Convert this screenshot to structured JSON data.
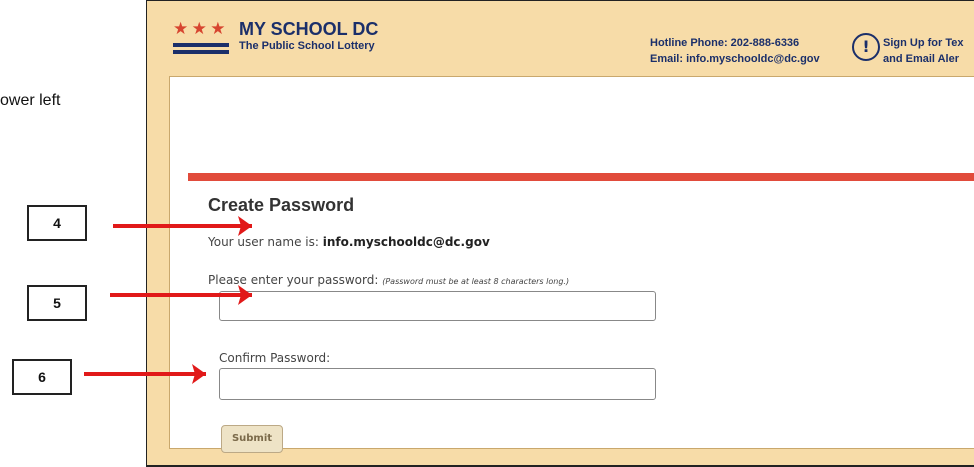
{
  "document": {
    "fragment": "ower left"
  },
  "header": {
    "brand": "MY SCHOOL DC",
    "tagline": "The Public School Lottery",
    "hotline": "Hotline Phone: 202-888-6336",
    "email": "Email: info.myschooldc@dc.gov",
    "alerts_line1": "Sign Up for Tex",
    "alerts_line2": "and Email Aler"
  },
  "form": {
    "title": "Create Password",
    "username_prefix": "Your user name is:",
    "username_value": "info.myschooldc@dc.gov",
    "password_label": "Please enter your password:",
    "password_note": "(Password must be at least 8 characters long.)",
    "password_value": "",
    "confirm_label": "Confirm Password:",
    "confirm_value": "",
    "submit_label": "Submit"
  },
  "callouts": [
    "4",
    "5",
    "6"
  ],
  "colors": {
    "arrow": "#e11919",
    "brand": "#1b2f6a",
    "banner": "#f7dca8",
    "accent_bar": "#e14b3b"
  }
}
